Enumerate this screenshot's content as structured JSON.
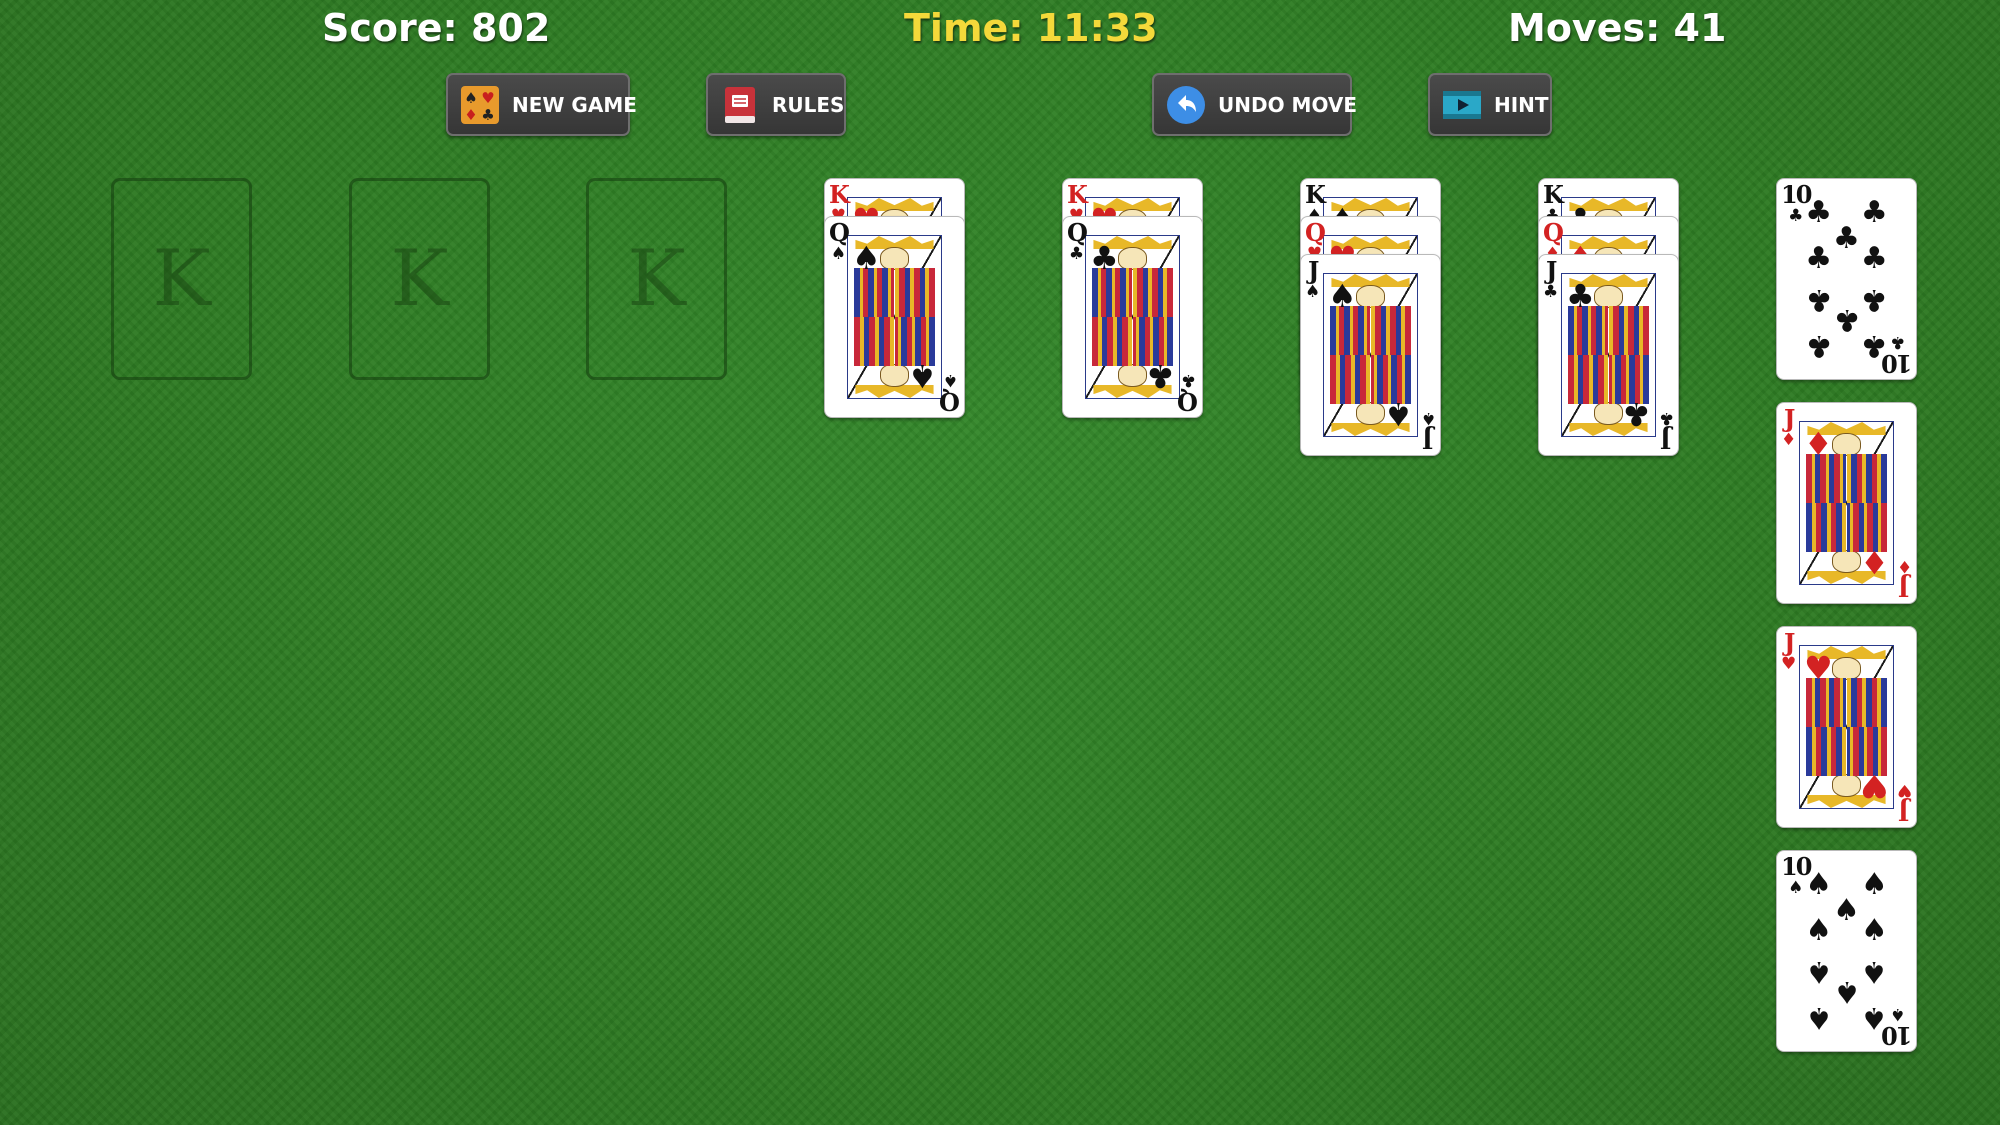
{
  "stats": {
    "score": "Score: 802",
    "time": "Time: 11:33",
    "moves": "Moves: 41"
  },
  "buttons": {
    "new_game": {
      "label": "NEW GAME",
      "icon": "cards-icon"
    },
    "rules": {
      "label": "RULES",
      "icon": "book-icon"
    },
    "undo": {
      "label": "UNDO MOVE",
      "icon": "undo-arrow-icon"
    },
    "hint": {
      "label": "HINT",
      "icon": "film-play-icon"
    }
  },
  "empty_slots": [
    "K",
    "K",
    "K"
  ],
  "tableau": [
    [
      {
        "rank": "K",
        "suit": "♥",
        "color": "red"
      },
      {
        "rank": "Q",
        "suit": "♠",
        "color": "black"
      }
    ],
    [
      {
        "rank": "K",
        "suit": "♥",
        "color": "red"
      },
      {
        "rank": "Q",
        "suit": "♣",
        "color": "black"
      }
    ],
    [
      {
        "rank": "K",
        "suit": "♠",
        "color": "black"
      },
      {
        "rank": "Q",
        "suit": "♥",
        "color": "red"
      },
      {
        "rank": "J",
        "suit": "♠",
        "color": "black"
      }
    ],
    [
      {
        "rank": "K",
        "suit": "♣",
        "color": "black"
      },
      {
        "rank": "Q",
        "suit": "♦",
        "color": "red"
      },
      {
        "rank": "J",
        "suit": "♣",
        "color": "black"
      }
    ]
  ],
  "reserve": [
    {
      "rank": "10",
      "suit": "♣",
      "color": "black"
    },
    {
      "rank": "J",
      "suit": "♦",
      "color": "red"
    },
    {
      "rank": "J",
      "suit": "♥",
      "color": "red"
    },
    {
      "rank": "10",
      "suit": "♠",
      "color": "black"
    }
  ],
  "colors": {
    "felt": "#2f7f24",
    "time_text": "#f4d93a",
    "red_suit": "#d32222",
    "black_suit": "#111111"
  }
}
